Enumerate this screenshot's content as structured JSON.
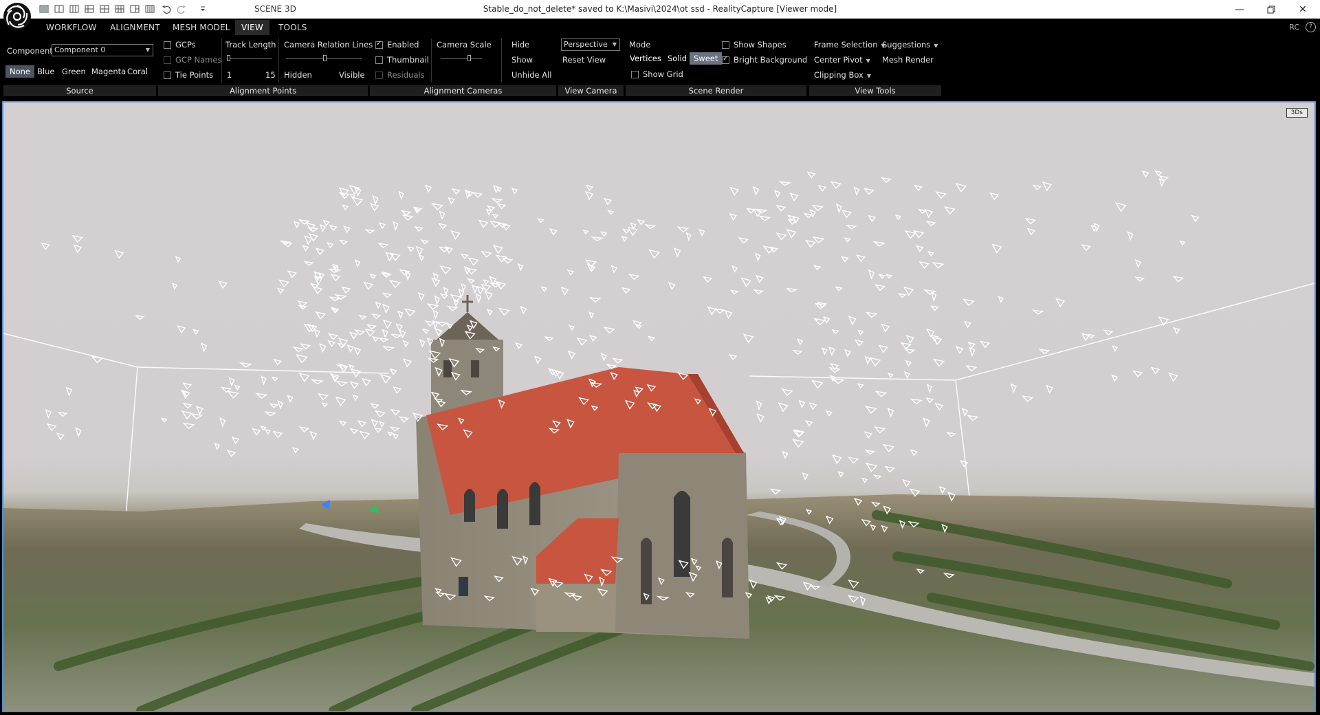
{
  "window": {
    "title": "Stable_do_not_delete* saved to K:\\Masivi\\2024\\ot ssd - RealityCapture [Viewer mode]",
    "scene_label": "SCENE 3D",
    "controls": [
      "minimize-icon",
      "restore-icon",
      "close-icon"
    ]
  },
  "quick_access": [
    "layout-1-icon",
    "layout-2-icon",
    "layout-3-icon",
    "layout-4-icon",
    "layout-5-icon",
    "layout-6-icon",
    "layout-7-icon",
    "layout-8-icon",
    "undo-icon",
    "redo-icon",
    "customize-icon"
  ],
  "menu": {
    "tabs": [
      {
        "label": "WORKFLOW"
      },
      {
        "label": "ALIGNMENT"
      },
      {
        "label": "MESH MODEL"
      },
      {
        "label": "VIEW",
        "active": true
      },
      {
        "label": "TOOLS"
      }
    ],
    "rc_label": "RC",
    "help": "?"
  },
  "ribbon": {
    "source": {
      "title": "Source",
      "component_label": "Component",
      "component_value": "Component 0",
      "colors": [
        "None",
        "Blue",
        "Green",
        "Magenta",
        "Coral"
      ],
      "selected_color": "None"
    },
    "alignment_points": {
      "title": "Alignment Points",
      "gcps": "GCPs",
      "gcp_names": "GCP Names",
      "tie_points": "Tie Points",
      "track_length": "Track Length",
      "track_min": "1",
      "track_max": "15",
      "relation_lines": "Camera Relation Lines",
      "hidden": "Hidden",
      "visible": "Visible"
    },
    "alignment_cameras": {
      "title": "Alignment Cameras",
      "enabled": "Enabled",
      "thumbnail": "Thumbnail",
      "residuals": "Residuals",
      "camera_scale": "Camera Scale",
      "hide": "Hide",
      "show": "Show",
      "unhide_all": "Unhide All"
    },
    "view_camera": {
      "title": "View Camera",
      "projection": "Perspective",
      "reset_view": "Reset View"
    },
    "scene_render": {
      "title": "Scene Render",
      "mode": "Mode",
      "modes": [
        "Vertices",
        "Solid",
        "Sweet"
      ],
      "selected_mode": "Sweet",
      "show_grid": "Show Grid",
      "show_shapes": "Show Shapes",
      "bright_background": "Bright Background"
    },
    "view_tools": {
      "title": "View Tools",
      "frame_selection": "Frame Selection",
      "suggestions": "Suggestions",
      "center_pivot": "Center Pivot",
      "mesh_render": "Mesh Render",
      "clipping_box": "Clipping Box"
    }
  },
  "viewport": {
    "badge": "3Ds"
  },
  "colors": {
    "accent": "#4a90d9",
    "roof": "#c8553f",
    "wall": "#8e8677",
    "sky": "#d3cfd1"
  }
}
